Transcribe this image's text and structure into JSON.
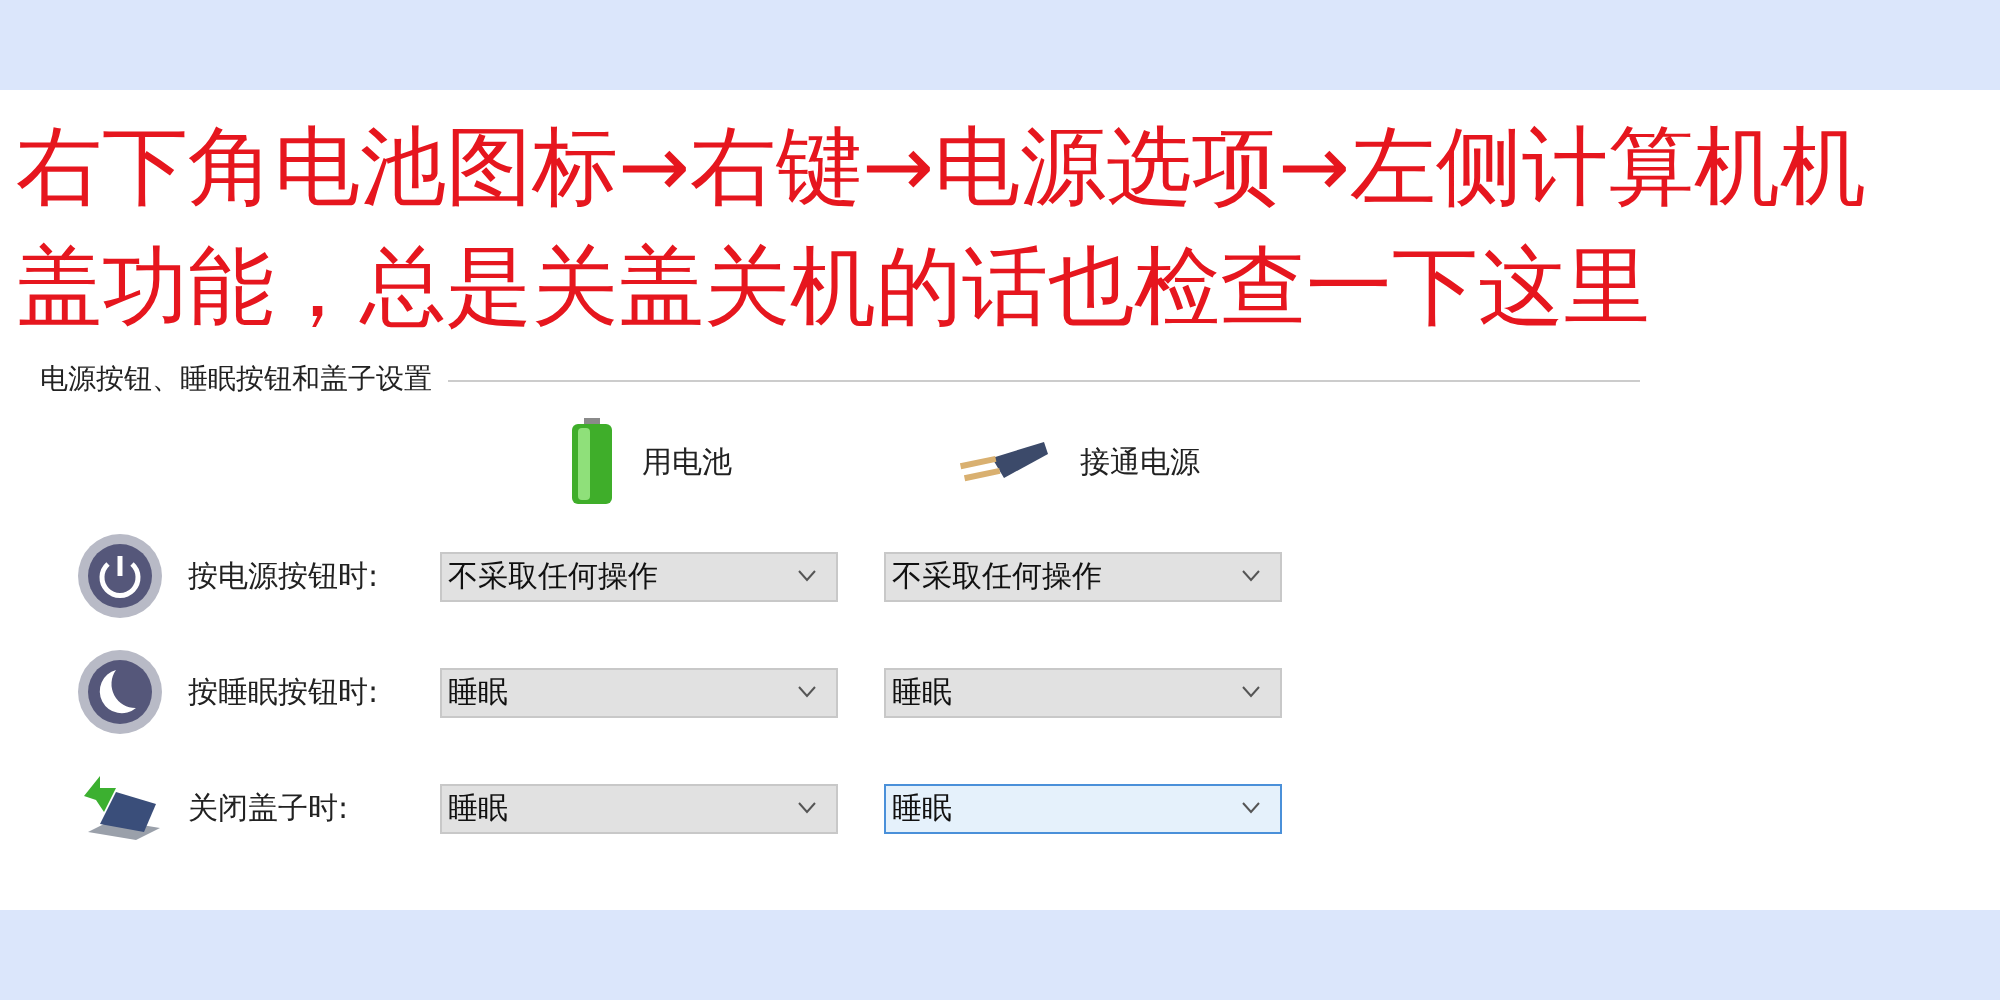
{
  "annotation": {
    "lines": [
      "右下角电池图标→右键→电源选项→左侧计算机机",
      "盖功能，总是关盖关机的话也检查一下这里"
    ]
  },
  "section": {
    "title": "电源按钮、睡眠按钮和盖子设置"
  },
  "columns": [
    {
      "kind": "battery",
      "label": "用电池"
    },
    {
      "kind": "plug",
      "label": "接通电源"
    }
  ],
  "rows": [
    {
      "kind": "power",
      "label": "按电源按钮时:",
      "dropdowns": [
        {
          "value": "不采取任何操作",
          "focused": false
        },
        {
          "value": "不采取任何操作",
          "focused": false
        }
      ]
    },
    {
      "kind": "sleep",
      "label": "按睡眠按钮时:",
      "dropdowns": [
        {
          "value": "睡眠",
          "focused": false
        },
        {
          "value": "睡眠",
          "focused": false
        }
      ]
    },
    {
      "kind": "lid",
      "label": "关闭盖子时:",
      "dropdowns": [
        {
          "value": "睡眠",
          "focused": false
        },
        {
          "value": "睡眠",
          "focused": true
        }
      ]
    }
  ]
}
